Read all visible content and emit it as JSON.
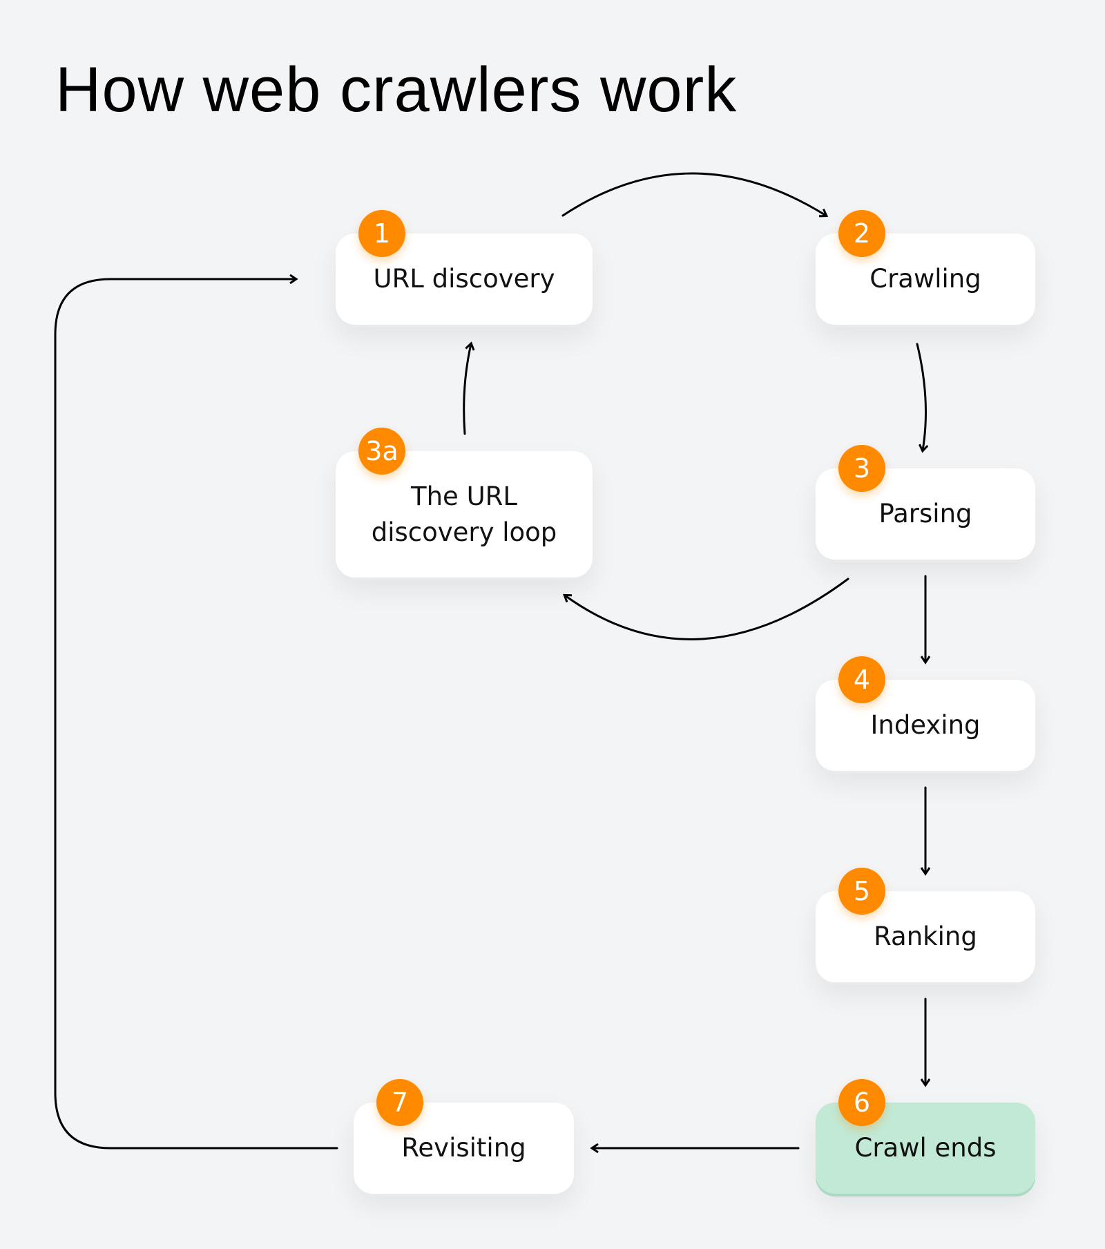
{
  "title": "How web crawlers work",
  "colors": {
    "badge": "#ff8a00",
    "final_step": "#c1e9d5",
    "background": "#f3f4f6"
  },
  "steps": [
    {
      "id": "1",
      "badge": "1",
      "label": "URL discovery"
    },
    {
      "id": "2",
      "badge": "2",
      "label": "Crawling"
    },
    {
      "id": "3",
      "badge": "3",
      "label": "Parsing"
    },
    {
      "id": "3a",
      "badge": "3a",
      "label": "The URL discovery loop"
    },
    {
      "id": "4",
      "badge": "4",
      "label": "Indexing"
    },
    {
      "id": "5",
      "badge": "5",
      "label": "Ranking"
    },
    {
      "id": "6",
      "badge": "6",
      "label": "Crawl ends"
    },
    {
      "id": "7",
      "badge": "7",
      "label": "Revisiting"
    }
  ],
  "connections": [
    {
      "from": "1",
      "to": "2"
    },
    {
      "from": "2",
      "to": "3"
    },
    {
      "from": "3",
      "to": "3a"
    },
    {
      "from": "3a",
      "to": "1"
    },
    {
      "from": "3",
      "to": "4"
    },
    {
      "from": "4",
      "to": "5"
    },
    {
      "from": "5",
      "to": "6"
    },
    {
      "from": "6",
      "to": "7"
    },
    {
      "from": "7",
      "to": "1"
    }
  ]
}
